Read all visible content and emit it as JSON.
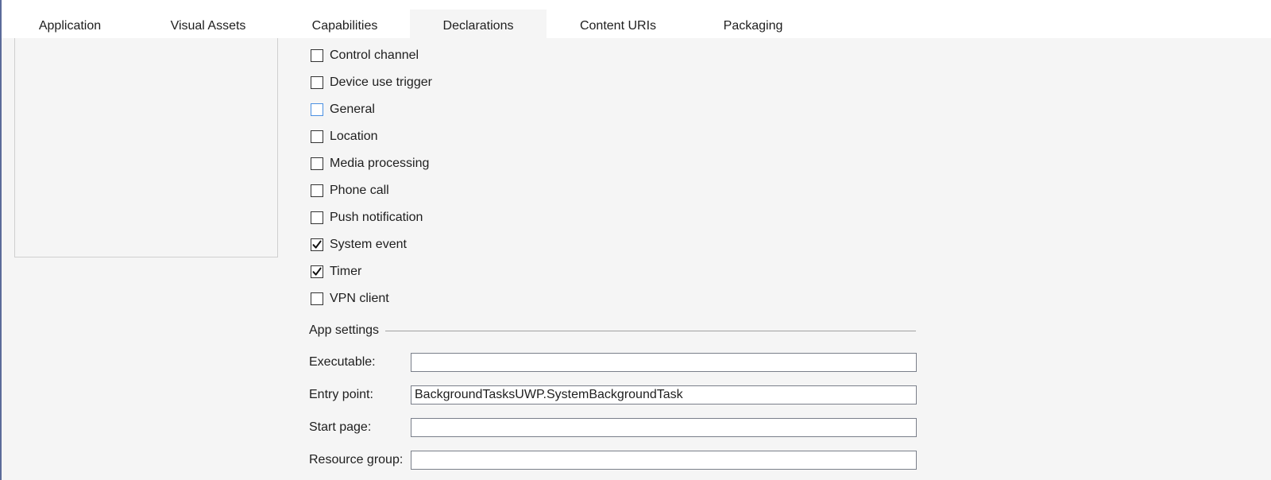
{
  "tabs": [
    {
      "label": "Application"
    },
    {
      "label": "Visual Assets"
    },
    {
      "label": "Capabilities"
    },
    {
      "label": "Declarations",
      "active": true
    },
    {
      "label": "Content URIs"
    },
    {
      "label": "Packaging"
    }
  ],
  "tasks": [
    {
      "label": "Control channel",
      "checked": false
    },
    {
      "label": "Device use trigger",
      "checked": false
    },
    {
      "label": "General",
      "checked": false,
      "focused": true
    },
    {
      "label": "Location",
      "checked": false
    },
    {
      "label": "Media processing",
      "checked": false
    },
    {
      "label": "Phone call",
      "checked": false
    },
    {
      "label": "Push notification",
      "checked": false
    },
    {
      "label": "System event",
      "checked": true
    },
    {
      "label": "Timer",
      "checked": true
    },
    {
      "label": "VPN client",
      "checked": false
    }
  ],
  "app_settings": {
    "title": "App settings",
    "executable_label": "Executable:",
    "executable_value": "",
    "entry_point_label": "Entry point:",
    "entry_point_value": "BackgroundTasksUWP.SystemBackgroundTask",
    "start_page_label": "Start page:",
    "start_page_value": "",
    "resource_group_label": "Resource group:",
    "resource_group_value": ""
  },
  "colors": {
    "page_bg": "#f5f5f5",
    "tab_bar_bg": "#ffffff",
    "focus_border": "#4a90e2",
    "window_edge": "#5b6b9a"
  }
}
